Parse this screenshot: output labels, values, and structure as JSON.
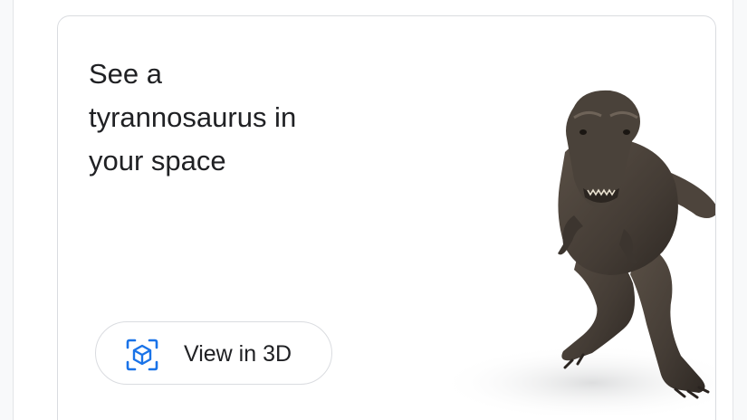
{
  "card": {
    "title_lines": [
      "See a",
      "tyrannosaurus in",
      "your space"
    ],
    "button": {
      "label": "View in 3D",
      "icon": "ar-cube-icon",
      "icon_color": "#1a73e8"
    },
    "image": {
      "subject": "tyrannosaurus"
    }
  },
  "colors": {
    "text": "#202124",
    "border": "#dadce0",
    "accent": "#1a73e8",
    "dino_body": "#4a423a"
  }
}
